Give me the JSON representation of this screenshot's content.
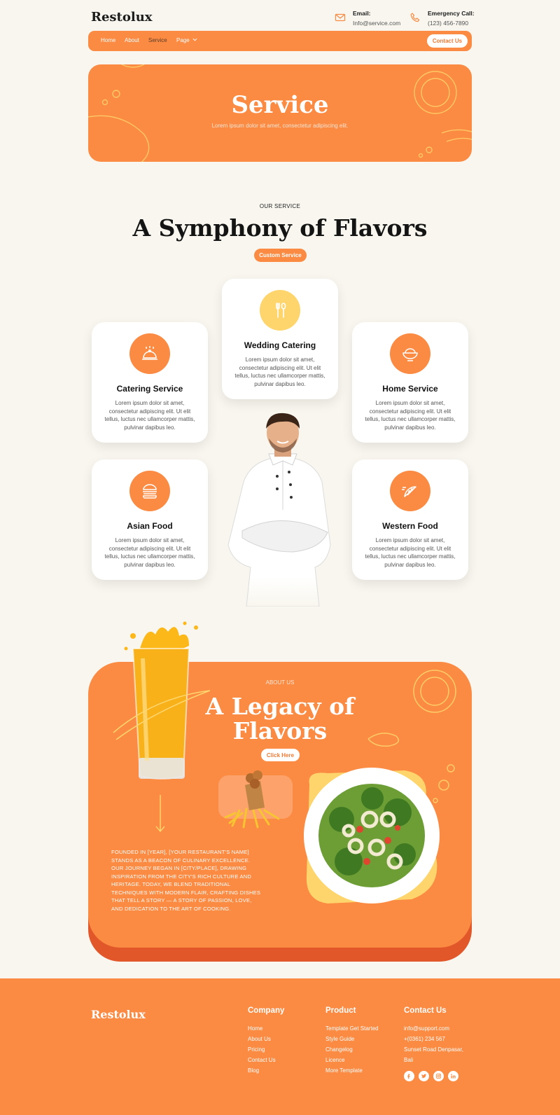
{
  "brand": {
    "name": "Restolux",
    "accent": "#fb8a42",
    "accent_dark": "#e2572a",
    "yellow": "#fdd56c",
    "background": "#f8f6ee"
  },
  "header": {
    "email_label": "Email:",
    "email_value": "Info@service.com",
    "phone_label": "Emergency Call:",
    "phone_value": "(123) 456-7890"
  },
  "nav": {
    "items": [
      "Home",
      "About",
      "Service",
      "Page"
    ],
    "active": "Service",
    "contact_button": "Contact Us"
  },
  "hero": {
    "title": "Service",
    "subtitle": "Lorem ipsum dolor sit amet, consectetur adipiscing elit."
  },
  "services": {
    "eyebrow": "OUR SERVICE",
    "title": "A Symphony of Flavors",
    "button": "Custom Service",
    "cards": [
      {
        "title": "Catering Service",
        "icon": "cloche-icon",
        "desc": "Lorem ipsum dolor sit amet, consectetur adipiscing elit. Ut elit tellus, luctus nec ullamcorper mattis, pulvinar dapibus leo."
      },
      {
        "title": "Wedding Catering",
        "icon": "fork-spoon-icon",
        "desc": "Lorem ipsum dolor sit amet, consectetur adipiscing elit. Ut elit tellus, luctus nec ullamcorper mattis, pulvinar dapibus leo."
      },
      {
        "title": "Home Service",
        "icon": "bowl-icon",
        "desc": "Lorem ipsum dolor sit amet, consectetur adipiscing elit. Ut elit tellus, luctus nec ullamcorper mattis, pulvinar dapibus leo."
      },
      {
        "title": "Asian Food",
        "icon": "burger-icon",
        "desc": "Lorem ipsum dolor sit amet, consectetur adipiscing elit. Ut elit tellus, luctus nec ullamcorper mattis, pulvinar dapibus leo."
      },
      {
        "title": "Western Food",
        "icon": "pizza-icon",
        "desc": "Lorem ipsum dolor sit amet, consectetur adipiscing elit. Ut elit tellus, luctus nec ullamcorper mattis, pulvinar dapibus leo."
      }
    ]
  },
  "about": {
    "eyebrow": "ABOUT US",
    "title_line1": "A Legacy of",
    "title_line2": "Flavors",
    "button": "Click Here",
    "text": "FOUNDED IN [YEAR], [YOUR RESTAURANT'S NAME] STANDS AS A BEACON OF CULINARY EXCELLENCE. OUR JOURNEY BEGAN IN [CITY/PLACE], DRAWING INSPIRATION FROM THE CITY'S RICH CULTURE AND HERITAGE. TODAY, WE BLEND TRADITIONAL TECHNIQUES WITH MODERN FLAIR, CRAFTING DISHES THAT TELL A STORY — A STORY OF PASSION, LOVE, AND DEDICATION TO THE ART OF COOKING."
  },
  "footer": {
    "logo": "Restolux",
    "company": {
      "heading": "Company",
      "links": [
        "Home",
        "About Us",
        "Pricing",
        "Contact Us",
        "Blog"
      ]
    },
    "product": {
      "heading": "Product",
      "links": [
        "Template Get Started",
        "Style Guide",
        "Changelog",
        "Licence",
        "More Template"
      ]
    },
    "contact": {
      "heading": "Contact Us",
      "email": "info@support.com",
      "phone": "+(0361) 234 567",
      "address_line1": "Sunset Road Denpasar,",
      "address_line2": "Bali"
    },
    "social": [
      "facebook-icon",
      "twitter-icon",
      "instagram-icon",
      "linkedin-icon"
    ]
  }
}
